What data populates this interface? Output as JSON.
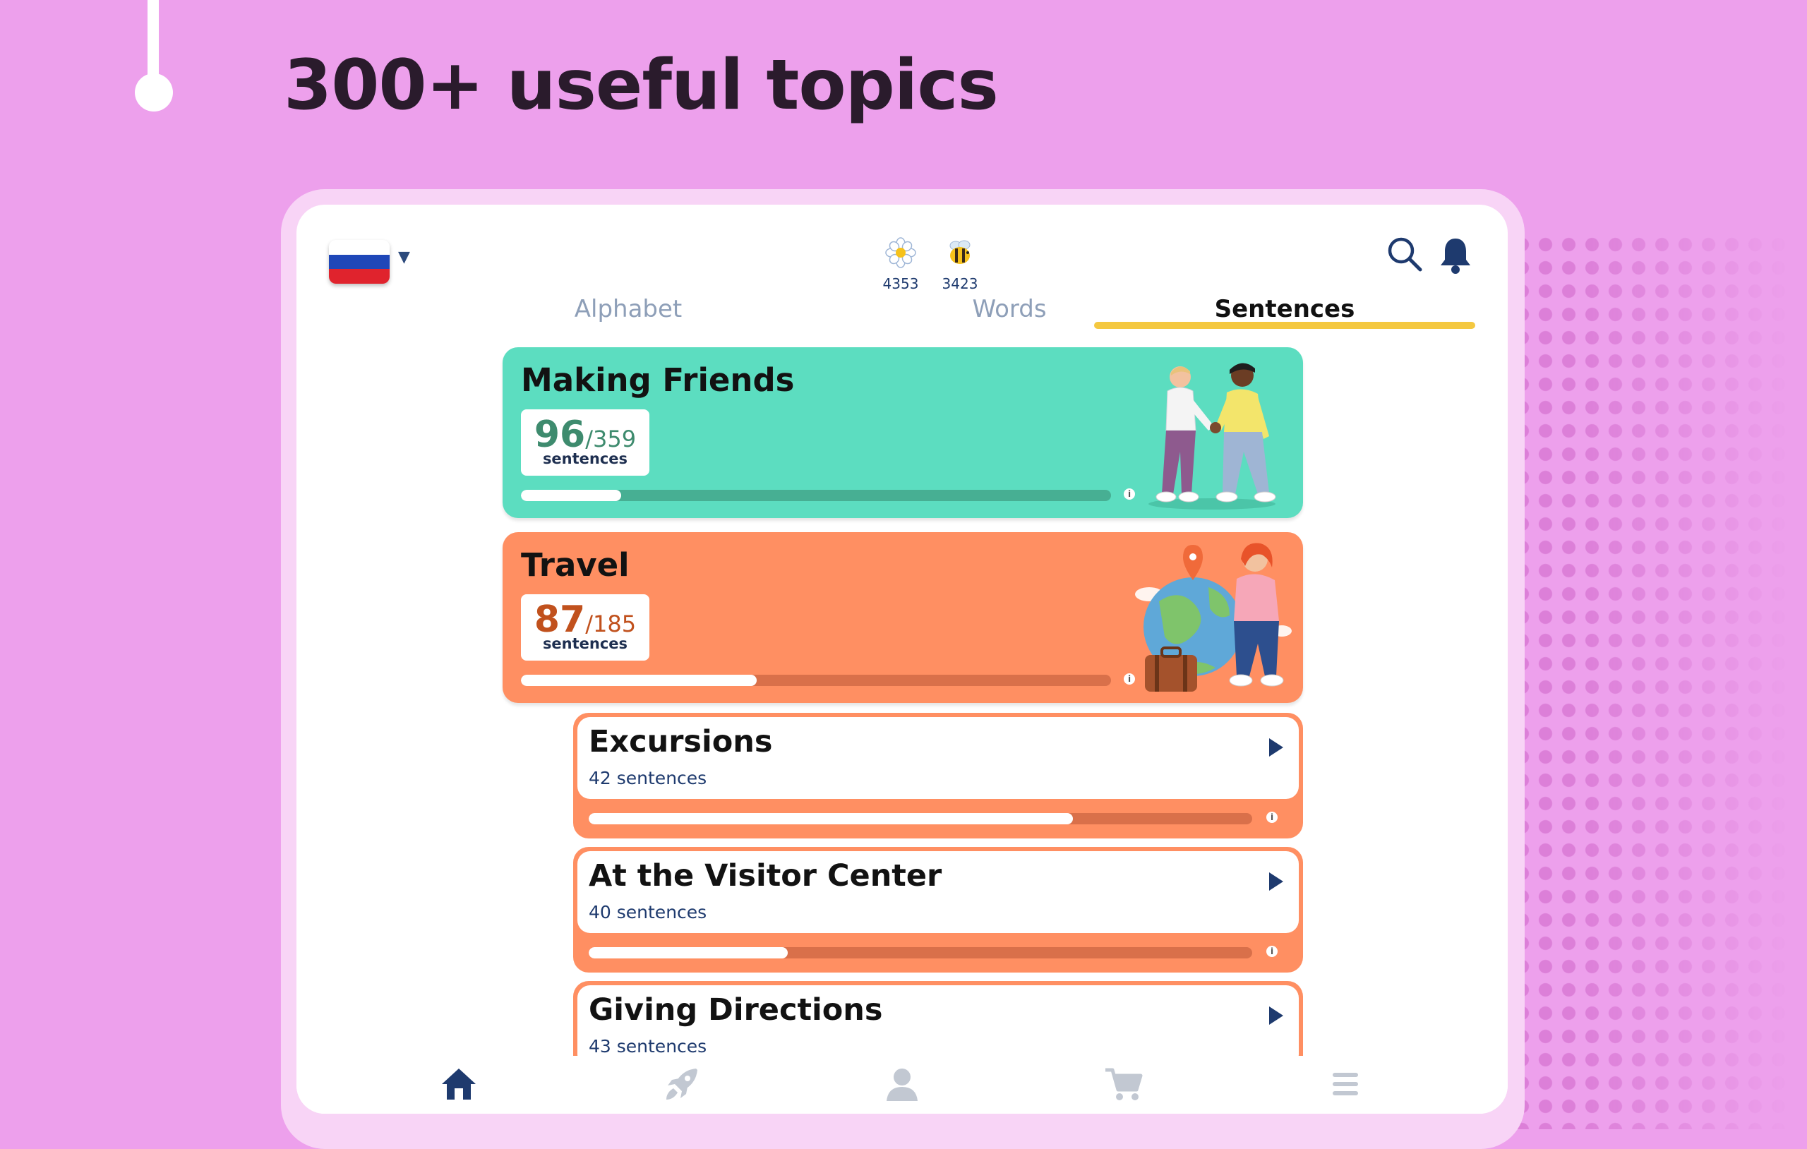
{
  "headline": "300+ useful topics",
  "colors": {
    "background": "#eda0ec",
    "accent": "#f4c840",
    "green_card": "#5cddc0",
    "orange_card": "#ff8f62",
    "icon_blue": "#2c4a7c"
  },
  "header": {
    "language_flag": "russia-flag-icon",
    "stats": [
      {
        "icon": "flower-icon",
        "value": "4353"
      },
      {
        "icon": "bee-icon",
        "value": "3423"
      }
    ],
    "icons": [
      "search-icon",
      "bell-icon"
    ]
  },
  "tabs": [
    {
      "label": "Alphabet",
      "active": false
    },
    {
      "label": "Words",
      "active": false
    },
    {
      "label": "Sentences",
      "active": true
    }
  ],
  "topics": [
    {
      "title": "Making Friends",
      "done": "96",
      "total": "/359",
      "unit": "sentences",
      "progress": 0.17,
      "color": "green"
    },
    {
      "title": "Travel",
      "done": "87",
      "total": "/185",
      "unit": "sentences",
      "progress": 0.4,
      "color": "orange"
    }
  ],
  "subtopics": [
    {
      "title": "Excursions",
      "count": "42 sentences",
      "progress": 0.73
    },
    {
      "title": "At the Visitor Center",
      "count": "40 sentences",
      "progress": 0.3
    },
    {
      "title": "Giving Directions",
      "count": "43 sentences",
      "progress": 0.0
    }
  ],
  "bottom_nav": [
    {
      "icon": "home-icon",
      "active": true
    },
    {
      "icon": "rocket-icon",
      "active": false
    },
    {
      "icon": "profile-icon",
      "active": false
    },
    {
      "icon": "cart-icon",
      "active": false
    },
    {
      "icon": "menu-icon",
      "active": false
    }
  ]
}
